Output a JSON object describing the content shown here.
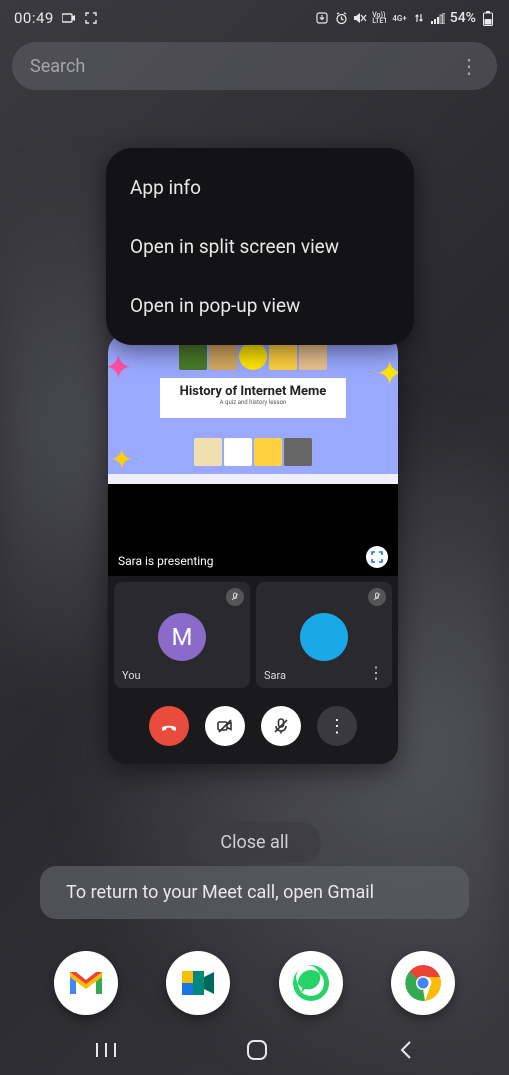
{
  "status": {
    "time": "00:49",
    "battery": "54%",
    "network": "4G+",
    "lte": "LTE1",
    "volte": "Vo))"
  },
  "search": {
    "placeholder": "Search"
  },
  "ctx": {
    "app_info": "App info",
    "split": "Open in split screen view",
    "popup": "Open in pop-up view"
  },
  "call": {
    "slide_title": "History of Internet Meme",
    "slide_sub": "A quiz and history lesson",
    "presenting": "Sara is presenting",
    "you_label": "You",
    "you_initial": "M",
    "sara_label": "Sara"
  },
  "close_all": "Close all",
  "toast": "To return to your Meet call, open Gmail"
}
